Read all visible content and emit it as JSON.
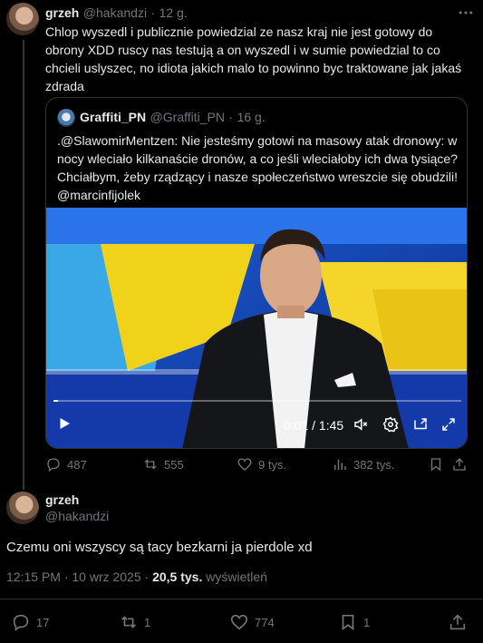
{
  "reply_tweet": {
    "author_name": "grzeh",
    "author_handle": "@hakandzi",
    "time_ago": "12 g.",
    "text": "Chlop wyszedl i publicznie powiedzial ze nasz kraj nie jest gotowy do obrony XDD ruscy nas testują a on wyszedl i w sumie powiedzial to co chcieli uslyszec, no idiota jakich malo to powinno byc traktowane jak jakaś zdrada",
    "quoted": {
      "author_name": "Graffiti_PN",
      "author_handle": "@Graffiti_PN",
      "time_ago": "16 g.",
      "text": ".@SlawomirMentzen: Nie jesteśmy gotowi na masowy atak dronowy: w nocy wleciało kilkanaście dronów, a co jeśli wleciałoby ich dwa tysiące? Chciałbym, żeby rządzący i nasze społeczeństwo wreszcie się obudzili! @marcinfijolek",
      "video_time": "0:01 / 1:45",
      "video_progress": 0.01
    },
    "stats": {
      "replies": "487",
      "reposts": "555",
      "likes": "9 tys.",
      "views": "382 tys."
    }
  },
  "main_tweet": {
    "author_name": "grzeh",
    "author_handle": "@hakandzi",
    "text": "Czemu oni wszyscy są tacy bezkarni ja pierdole xd",
    "timestamp": "12:15 PM · 10 wrz 2025 · ",
    "views_count": "20,5 tys.",
    "views_label": " wyświetleń",
    "stats": {
      "replies": "17",
      "reposts": "1",
      "likes": "774",
      "bookmarks": "1"
    }
  },
  "icons": [
    "more-icon",
    "reply-icon",
    "repost-icon",
    "like-icon",
    "views-icon",
    "bookmark-icon",
    "share-icon",
    "play-icon",
    "volume-muted-icon",
    "settings-icon",
    "pip-icon",
    "fullscreen-icon"
  ]
}
